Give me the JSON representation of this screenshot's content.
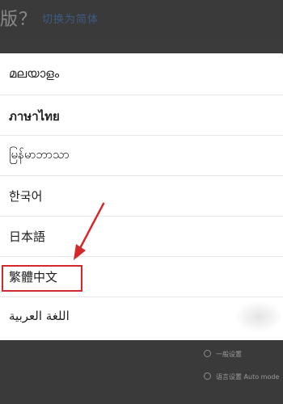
{
  "background": {
    "title": "版？",
    "title_link": "切换为简体",
    "options": [
      {
        "label": "一般设置"
      },
      {
        "label": "语言设置 Auto mode"
      }
    ]
  },
  "dialog": {
    "languages": [
      {
        "label": "മലയാളം"
      },
      {
        "label": "ภาษาไทย"
      },
      {
        "label": "မြန်မာဘာသာ"
      },
      {
        "label": "한국어"
      },
      {
        "label": "日本語"
      },
      {
        "label": "繁體中文",
        "highlighted": true
      },
      {
        "label": "اللغة العربية"
      }
    ]
  },
  "colors": {
    "highlight_border": "#d6282a",
    "arrow": "#d6282a",
    "overlay": "#3b3b3b"
  }
}
